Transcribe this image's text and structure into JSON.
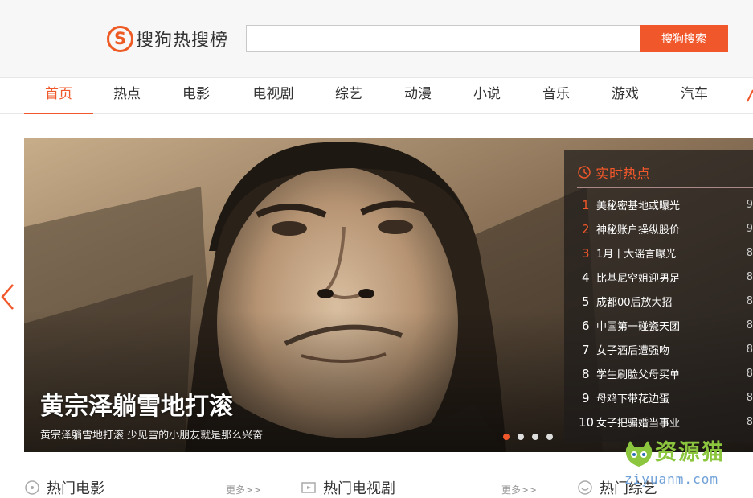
{
  "header": {
    "logo_letter": "S",
    "logo_text": "搜狗热搜榜",
    "search_value": "",
    "search_button": "搜狗搜索"
  },
  "nav": {
    "items": [
      {
        "label": "首页",
        "active": true
      },
      {
        "label": "热点",
        "active": false
      },
      {
        "label": "电影",
        "active": false
      },
      {
        "label": "电视剧",
        "active": false
      },
      {
        "label": "综艺",
        "active": false
      },
      {
        "label": "动漫",
        "active": false
      },
      {
        "label": "小说",
        "active": false
      },
      {
        "label": "音乐",
        "active": false
      },
      {
        "label": "游戏",
        "active": false
      },
      {
        "label": "汽车",
        "active": false
      }
    ]
  },
  "banner": {
    "title": "黄宗泽躺雪地打滚",
    "subtitle": "黄宗泽躺雪地打滚 少见雪的小朋友就是那么兴奋",
    "dot_count": 4,
    "active_dot": 0
  },
  "hot": {
    "title": "实时热点",
    "items": [
      {
        "rank": "1",
        "text": "美秘密基地或曝光",
        "cut": "9"
      },
      {
        "rank": "2",
        "text": "神秘账户操纵股价",
        "cut": "9"
      },
      {
        "rank": "3",
        "text": "1月十大谣言曝光",
        "cut": "8"
      },
      {
        "rank": "4",
        "text": "比基尼空姐迎男足",
        "cut": "8"
      },
      {
        "rank": "5",
        "text": "成都00后放大招",
        "cut": "8"
      },
      {
        "rank": "6",
        "text": "中国第一碰瓷天团",
        "cut": "8"
      },
      {
        "rank": "7",
        "text": "女子酒后遭强吻",
        "cut": "8"
      },
      {
        "rank": "8",
        "text": "学生刷脸父母买单",
        "cut": "8"
      },
      {
        "rank": "9",
        "text": "母鸡下带花边蛋",
        "cut": "8"
      },
      {
        "rank": "10",
        "text": "女子把骗婚当事业",
        "cut": "8"
      }
    ]
  },
  "sections": [
    {
      "title": "热门电影",
      "more": "更多>>"
    },
    {
      "title": "热门电视剧",
      "more": "更多>>"
    },
    {
      "title": "热门综艺",
      "more": ""
    }
  ],
  "watermark": {
    "text": "资源猫",
    "url": "ziyuanm.com"
  },
  "colors": {
    "accent": "#f0572a",
    "header_bg": "#f7f7f7"
  }
}
